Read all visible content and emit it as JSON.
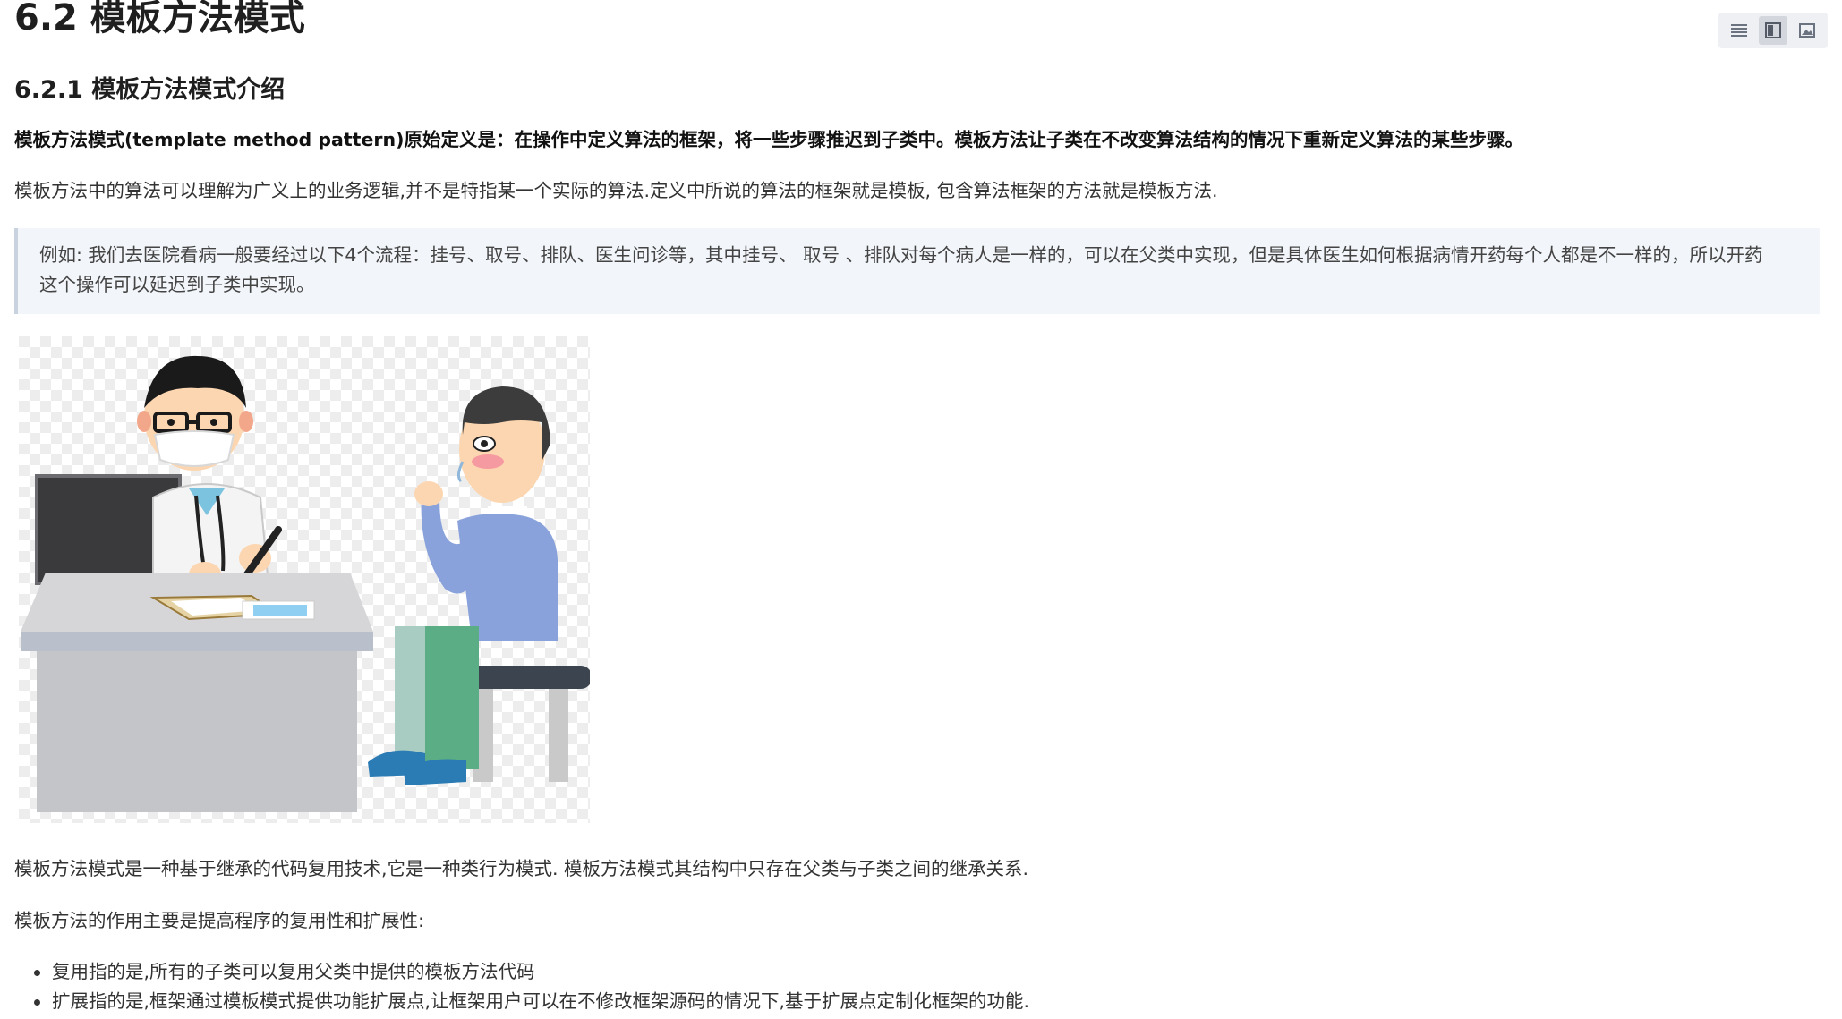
{
  "page": {
    "title": "6.2 模板方法模式",
    "section_title": "6.2.1 模板方法模式介绍",
    "definition": "模板方法模式(template method pattern)原始定义是：在操作中定义算法的框架，将一些步骤推迟到子类中。模板方法让子类在不改变算法结构的情况下重新定义算法的某些步骤。",
    "para1": "模板方法中的算法可以理解为广义上的业务逻辑,并不是特指某一个实际的算法.定义中所说的算法的框架就是模板, 包含算法框架的方法就是模板方法.",
    "quote_line1": "例如: 我们去医院看病一般要经过以下4个流程：挂号、取号、排队、医生问诊等，其中挂号、 取号 、排队对每个病人是一样的，可以在父类中实现，但是具体医生如何根据病情开药每个人都是不一样的，所以开药",
    "quote_line2": "这个操作可以延迟到子类中实现。",
    "para2": "模板方法模式是一种基于继承的代码复用技术,它是一种类行为模式. 模板方法模式其结构中只存在父类与子类之间的继承关系.",
    "para3": "模板方法的作用主要是提高程序的复用性和扩展性:",
    "list_items": [
      "复用指的是,所有的子类可以复用父类中提供的模板方法代码",
      "扩展指的是,框架通过模板模式提供功能扩展点,让框架用户可以在不修改框架源码的情况下,基于扩展点定制化框架的功能."
    ]
  },
  "toolbar": {
    "buttons": [
      {
        "icon": "list-view-icon",
        "active": false
      },
      {
        "icon": "split-view-icon",
        "active": true
      },
      {
        "icon": "image-view-icon",
        "active": false
      }
    ]
  },
  "colors": {
    "quote_bg": "#f2f5f9",
    "quote_border": "#c9d3e0",
    "doctor_hair": "#1a1a1a",
    "patient_shirt": "#8aa2dc",
    "patient_pants": "#5aad84",
    "shoes": "#2b7bb5",
    "desk": "#c3c5c9"
  }
}
